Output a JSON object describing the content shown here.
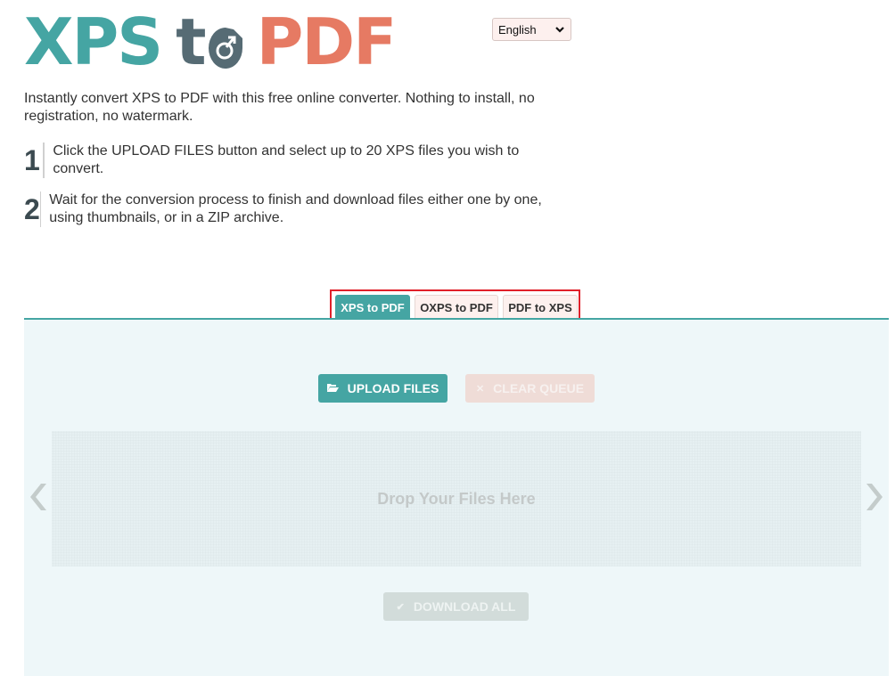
{
  "logo": {
    "part1": "XPS",
    "part2": "t",
    "part3": "PDF",
    "colors": {
      "xps": "#45a5a3",
      "to": "#566b74",
      "pdf": "#e67a63"
    }
  },
  "language": {
    "selected": "English"
  },
  "intro": "Instantly convert XPS to PDF with this free online converter. Nothing to install, no registration, no watermark.",
  "steps": [
    {
      "number": "1",
      "text": "Click the UPLOAD FILES button and select up to 20 XPS files you wish to convert."
    },
    {
      "number": "2",
      "text": "Wait for the conversion process to finish and download files either one by one, using thumbnails, or in a ZIP archive."
    }
  ],
  "tabs": [
    {
      "label": "XPS to PDF",
      "active": true
    },
    {
      "label": "OXPS to PDF",
      "active": false
    },
    {
      "label": "PDF to XPS",
      "active": false
    }
  ],
  "buttons": {
    "upload": "UPLOAD FILES",
    "clear": "CLEAR QUEUE",
    "download": "DOWNLOAD ALL"
  },
  "icons": {
    "upload": "folder-open-icon",
    "clear": "close-icon",
    "download": "checkmark-icon",
    "prev": "chevron-left-icon",
    "next": "chevron-right-icon"
  },
  "dropzone": {
    "text": "Drop Your Files Here"
  },
  "accent_color": "#45a5a3"
}
